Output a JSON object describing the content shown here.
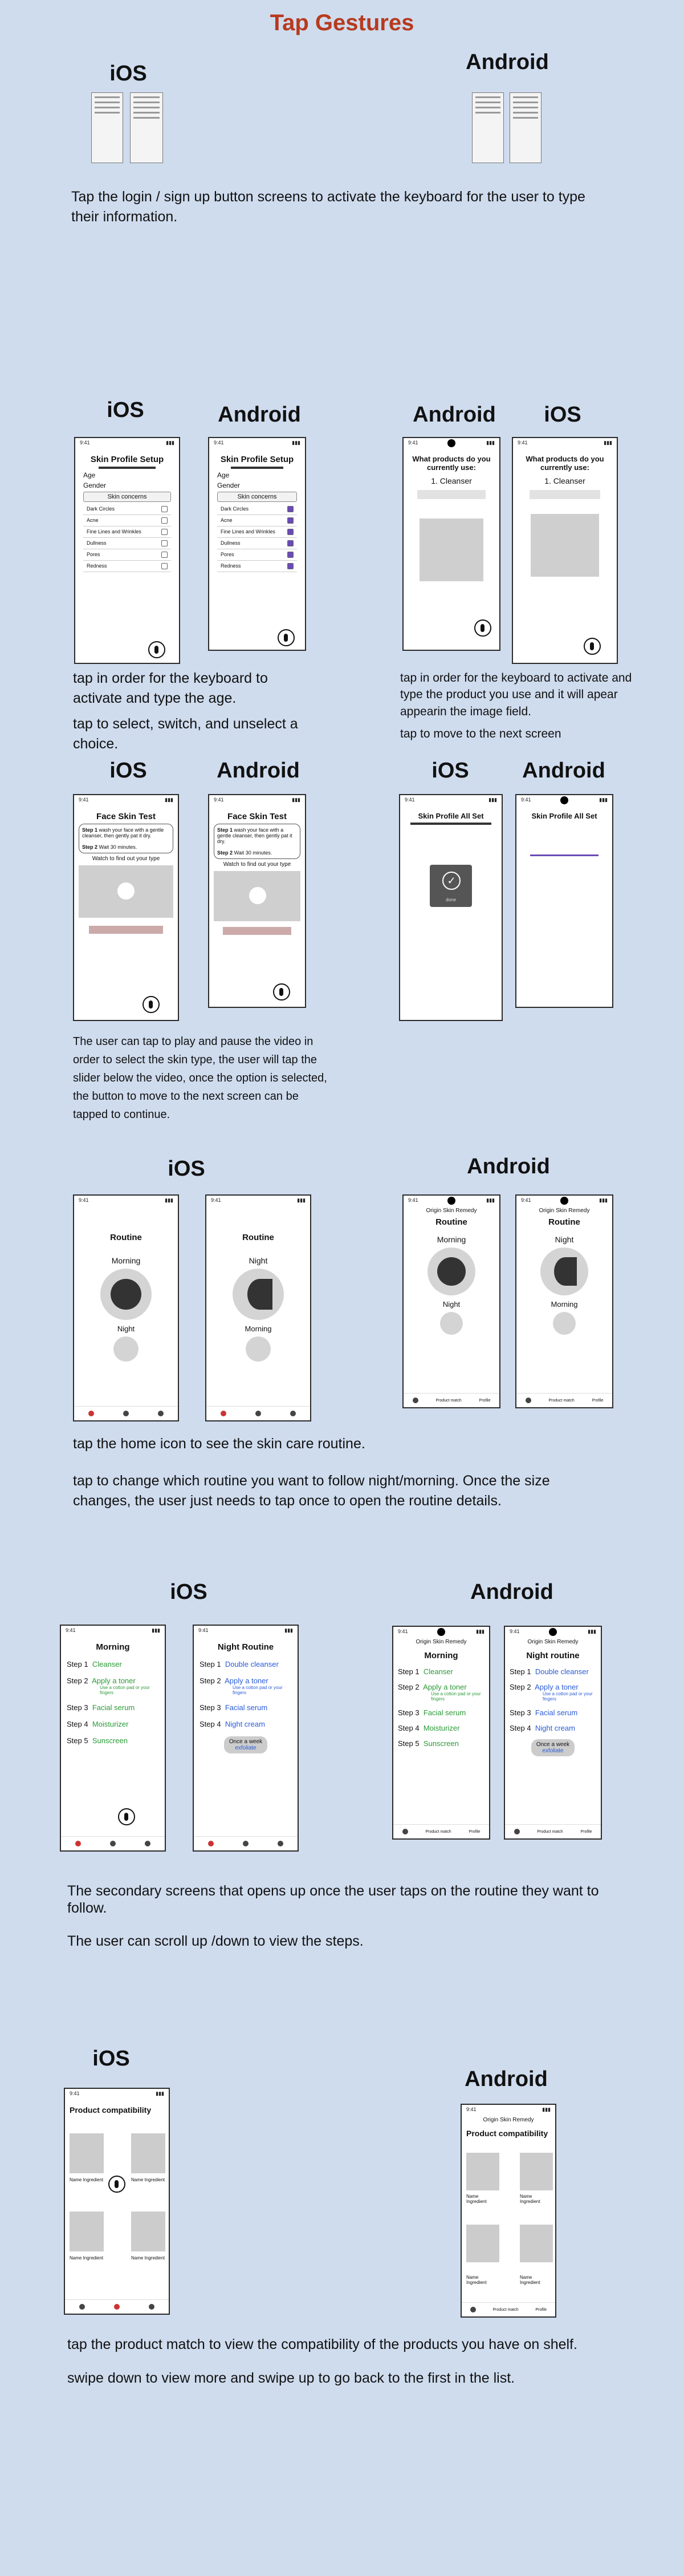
{
  "title": "Tap Gestures",
  "platforms": {
    "ios": "iOS",
    "android": "Android"
  },
  "captions": {
    "login": "Tap the login / sign up button screens to activate the keyboard for the user to type their information.",
    "profile_1": "tap in order for the keyboard to activate and type the age.",
    "profile_2": "tap to select, switch, and unselect a choice.",
    "products_1": "tap in order for the keyboard to activate and type the product you use and it will apear appearin the image field.",
    "products_2": "tap to move to the next screen",
    "video": "The user can tap to play and pause the video in order to select the skin type, the user will tap the slider below the video, once the option is selected, the button to move to the next screen can be tapped to continue.",
    "home_1": "tap the home icon to see the skin care routine.",
    "home_2": "tap to change which routine you want to follow night/morning. Once the size changes, the user just needs to tap once to open the routine details.",
    "steps_1": "The secondary screens that opens up once the user taps on the routine they want to follow.",
    "steps_2": "The user can scroll up /down to view the steps.",
    "compat_1": "tap the product match to view the compatibility of the products you have on shelf.",
    "compat_2": "swipe down to view more and swipe up to go back to the first in the list."
  },
  "screens": {
    "status_time": "9:41",
    "skin_profile_setup": "Skin Profile Setup",
    "age": "Age",
    "gender": "Gender",
    "skin_concerns": "Skin concerns",
    "concerns": [
      "Dark Circles",
      "Acne",
      "Fine Lines and Wrinkles",
      "Dullness",
      "Pores",
      "Redness"
    ],
    "products_q": "What products do you currently use:",
    "cleanser": "1. Cleanser",
    "face_skin_test": "Face Skin Test",
    "step1_label": "Step 1",
    "step1_text": "wash your face with a gentle cleanser, then gently pat it dry.",
    "step2_label": "Step 2",
    "step2_text": "Wait 30 minutes.",
    "watch": "Watch to find out your type",
    "all_set": "Skin Profile All Set",
    "done": "done",
    "routine": "Routine",
    "morning": "Morning",
    "night": "Night",
    "app_name": "Origin Skin Remedy",
    "morning_title": "Morning",
    "night_title": "Night Routine",
    "night_title_android": "Night routine",
    "steps_labels": [
      "Step 1",
      "Step 2",
      "Step 3",
      "Step 4",
      "Step 5"
    ],
    "morning_steps": [
      "Cleanser",
      "Apply a toner",
      "Facial serum",
      "Moisturizer",
      "Sunscreen"
    ],
    "night_steps": [
      "Double cleanser",
      "Apply a toner",
      "Facial serum",
      "Night cream"
    ],
    "toner_sub": "Use a cotton pad or your fingers",
    "once_week": "Once a week",
    "exfoliate": "exfoliate",
    "product_compat": "Product compatibility",
    "name_ingredient": "Name Ingredient",
    "nav_home": "Home",
    "nav_product": "Product match",
    "nav_profile": "Profile"
  },
  "colors": {
    "title": "#b73a1e",
    "background": "#cfdcee",
    "green": "#2b9a37",
    "blue": "#2a5bd7"
  }
}
